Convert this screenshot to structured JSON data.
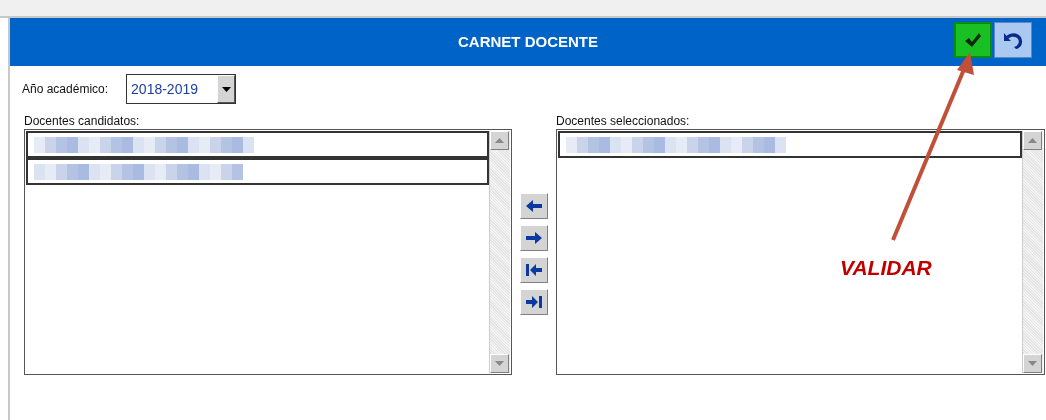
{
  "header": {
    "title": "CARNET DOCENTE"
  },
  "academic_year": {
    "label": "Año académico:",
    "value": "2018-2019"
  },
  "candidates": {
    "label": "Docentes candidatos:",
    "items": [
      {
        "kind": "blurred"
      },
      {
        "kind": "blurred"
      }
    ]
  },
  "selected_list": {
    "label": "Docentes seleccionados:",
    "items": [
      {
        "kind": "blurred"
      }
    ]
  },
  "annotation": {
    "text": "VALIDAR"
  }
}
